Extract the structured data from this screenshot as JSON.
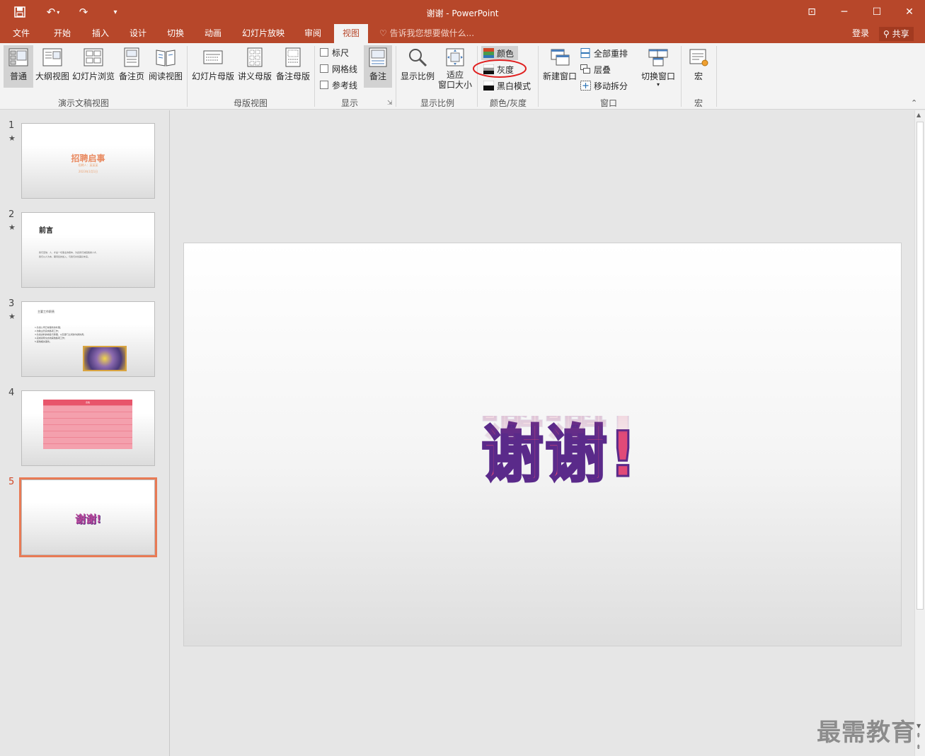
{
  "window": {
    "title": "谢谢 - PowerPoint",
    "controls": {
      "ribbon_display": "⊡",
      "minimize": "─",
      "maximize": "☐",
      "close": "✕"
    }
  },
  "quick_access": {
    "save": "save-icon",
    "undo": "undo-icon",
    "redo": "redo-icon",
    "customize": "customize-icon"
  },
  "tabs": [
    "文件",
    "开始",
    "插入",
    "设计",
    "切换",
    "动画",
    "幻灯片放映",
    "审阅",
    "视图"
  ],
  "active_tab": "视图",
  "tell_me": "告诉我您想要做什么...",
  "signin": "登录",
  "share": "共享",
  "ribbon": {
    "presentation_views": {
      "label": "演示文稿视图",
      "buttons": [
        "普通",
        "大纲视图",
        "幻灯片浏览",
        "备注页",
        "阅读视图"
      ]
    },
    "master_views": {
      "label": "母版视图",
      "buttons": [
        "幻灯片母版",
        "讲义母版",
        "备注母版"
      ]
    },
    "show": {
      "label": "显示",
      "checkboxes": [
        "标尺",
        "网格线",
        "参考线"
      ],
      "notes": "备注"
    },
    "zoom": {
      "label": "显示比例",
      "zoom_btn": "显示比例",
      "fit_line1": "适应",
      "fit_line2": "窗口大小"
    },
    "color_grayscale": {
      "label": "颜色/灰度",
      "color": "颜色",
      "grayscale": "灰度",
      "bw": "黑白模式"
    },
    "window": {
      "label": "窗口",
      "new_window": "新建窗口",
      "arrange_all": "全部重排",
      "cascade": "层叠",
      "move_split": "移动拆分",
      "switch_windows": "切换窗口"
    },
    "macros": {
      "label": "宏",
      "macros": "宏"
    }
  },
  "slides": [
    {
      "num": "1",
      "title": "招聘启事",
      "sub1": "招聘人：某某某",
      "sub2": "2023年1月1日"
    },
    {
      "num": "2",
      "title": "前言",
      "body1": "我们坚信：人、才是一切事业的根本，为此我们诚招各类人才，",
      "body2": "我们以人为本，期待您的加入，与我们共创美好未来。"
    },
    {
      "num": "3",
      "title": "主要工作职责",
      "bullets": [
        "1.负责公司日常事务的处理；",
        "2.协助主管完成各项工作；",
        "3.负责资料的收集与整理，以及部门之间的沟通协调；",
        "4.完成领导交办的其他各项工作；",
        "5.其他相关事务。"
      ]
    },
    {
      "num": "4",
      "title": "表格"
    },
    {
      "num": "5",
      "title": "谢谢!"
    }
  ],
  "selected_slide": "5",
  "current_slide": {
    "text": "谢谢!"
  },
  "watermark": "最需教育"
}
